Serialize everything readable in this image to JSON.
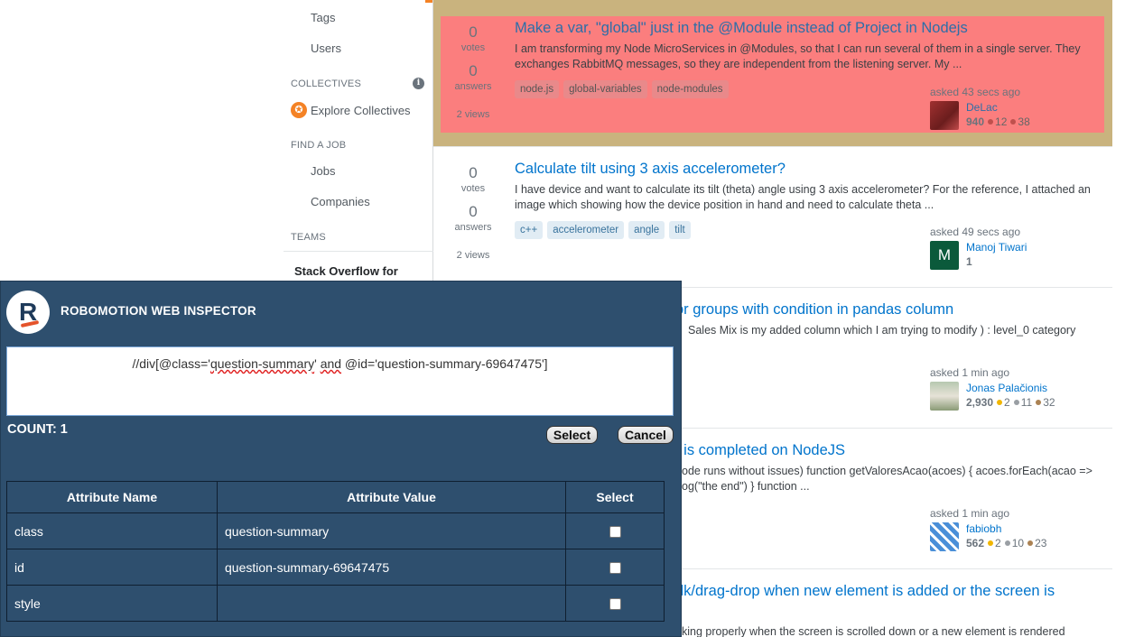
{
  "sidebar": {
    "tags_label": "Tags",
    "users_label": "Users",
    "collectives_heading": "COLLECTIVES",
    "explore_collectives": "Explore Collectives",
    "find_job_heading": "FIND A JOB",
    "jobs_label": "Jobs",
    "companies_label": "Companies",
    "teams_heading": "TEAMS",
    "teams_box_text": "Stack Overflow for"
  },
  "questions": [
    {
      "votes": "0",
      "votes_label": "votes",
      "answers": "0",
      "answers_label": "answers",
      "views": "2 views",
      "title": "Make a var, \"global\" just in the @Module instead of Project in Nodejs",
      "excerpt": "I am transforming my Node MicroServices in @Modules, so that I can run several of them in a single server. They exchanges RabbitMQ messages, so they are independent from the listening server. My ...",
      "tags": [
        "node.js",
        "global-variables",
        "node-modules"
      ],
      "asked": "asked 43 secs ago",
      "user": "DeLac",
      "rep": "940",
      "silver": "12",
      "bronze": "38"
    },
    {
      "votes": "0",
      "votes_label": "votes",
      "answers": "0",
      "answers_label": "answers",
      "views": "2 views",
      "title": "Calculate tilt using 3 axis accelerometer?",
      "excerpt": "I have device and want to calculate its tilt (theta) angle using 3 axis accelerometer? For the reference, I attached an image which showing how the device position in hand and need to calculate theta ...",
      "tags": [
        "c++",
        "accelerometer",
        "angle",
        "tilt"
      ],
      "asked": "asked 49 secs ago",
      "user": "Manoj Tiwari",
      "avatar_letter": "M",
      "rep": "1"
    },
    {
      "title": "or groups with condition in pandas column",
      "excerpt": "Sales Mix is my added column which I am trying to modify ) : level_0 category",
      "asked": "asked 1 min ago",
      "user": "Jonas Palačionis",
      "rep": "2,930",
      "gold": "2",
      "silver": "11",
      "bronze": "32"
    },
    {
      "title": "t is completed on NodeJS",
      "excerpt_line1": "ode runs without issues) function getValoresAcao(acoes) { acoes.forEach(acao =>",
      "excerpt_line2": "og(\"the end\") } function ...",
      "asked": "asked 1 min ago",
      "user": "fabiobh",
      "rep": "562",
      "gold": "2",
      "silver": "10",
      "bronze": "23"
    },
    {
      "title": "dk/drag-drop when new element is added or the screen is",
      "excerpt": "king properly when the screen is scrolled down or a new element is rendered"
    }
  ],
  "inspector": {
    "title": "ROBOMOTION WEB INSPECTOR",
    "xpath_pre": "//div[@class='",
    "xpath_u1": "question-summary",
    "xpath_mid": "' ",
    "xpath_u2": "and",
    "xpath_post": " @id='question-summary-69647475']",
    "count": "COUNT: 1",
    "select_button": "Select",
    "cancel_button": "Cancel",
    "table": {
      "headers": [
        "Attribute Name",
        "Attribute Value",
        "Select"
      ],
      "rows": [
        {
          "name": "class",
          "value": "question-summary"
        },
        {
          "name": "id",
          "value": "question-summary-69647475"
        },
        {
          "name": "style",
          "value": ""
        }
      ]
    }
  },
  "colors": {
    "highlight_outer": "#c9b37e",
    "highlight_inner": "#fb7e7e",
    "inspector_bg": "#2e4f6e",
    "link": "#0074cc"
  }
}
